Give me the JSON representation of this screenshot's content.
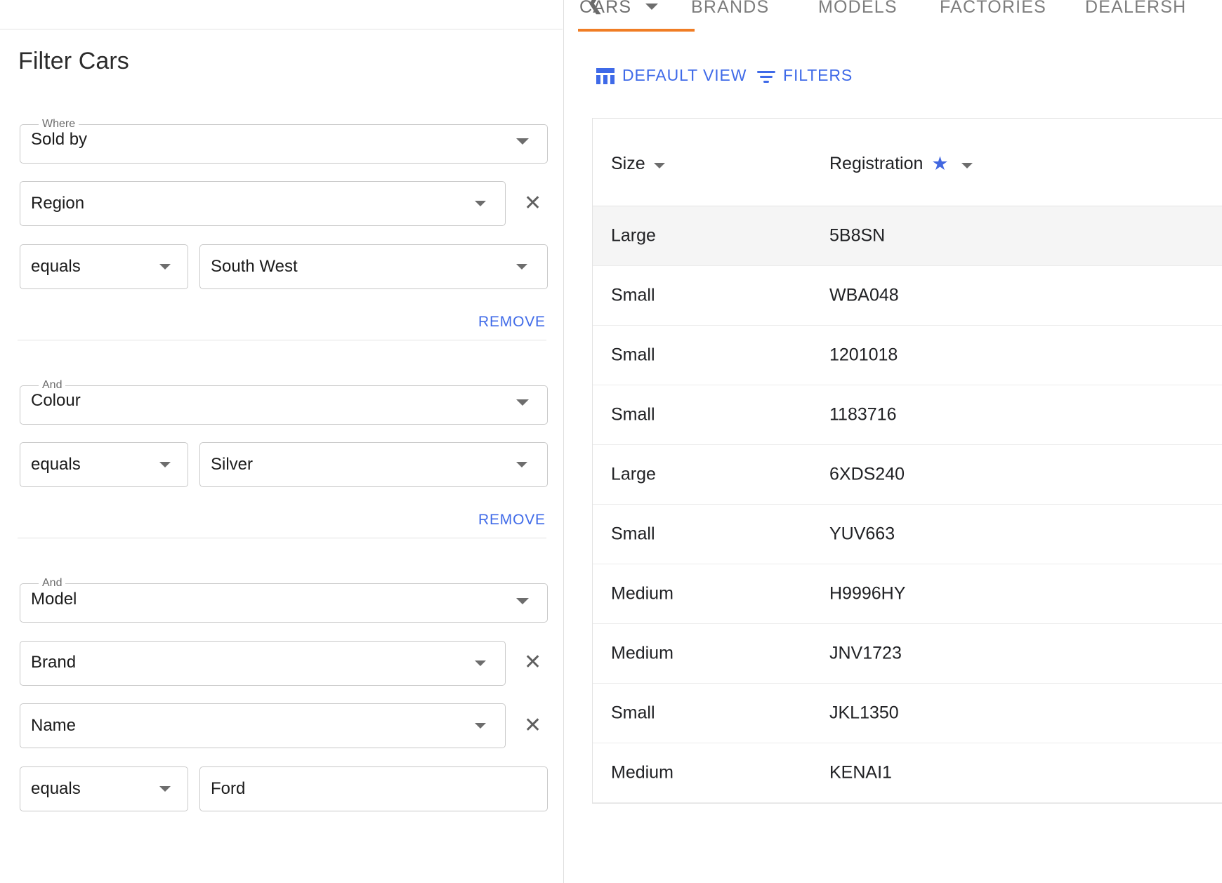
{
  "left_panel": {
    "title": "Filter Cars",
    "collapse_icon": "chevron-left-icon",
    "groups": [
      {
        "legend": "Where",
        "field": "Sold by",
        "subfield": "Region",
        "operator": "equals",
        "value": "South West",
        "remove_label": "REMOVE",
        "clear_icon": "close-icon"
      },
      {
        "legend": "And",
        "field": "Colour",
        "operator": "equals",
        "value": "Silver",
        "remove_label": "REMOVE"
      },
      {
        "legend": "And",
        "field": "Model",
        "subfield": "Brand",
        "subfield2": "Name",
        "operator": "equals",
        "value": "Ford",
        "clear_icon": "close-icon"
      }
    ]
  },
  "right_panel": {
    "tabs": [
      {
        "label": "CARS",
        "active": true,
        "has_caret": true
      },
      {
        "label": "BRANDS",
        "active": false,
        "has_caret": false
      },
      {
        "label": "MODELS",
        "active": false,
        "has_caret": false
      },
      {
        "label": "FACTORIES",
        "active": false,
        "has_caret": false
      },
      {
        "label": "DEALERSH",
        "active": false,
        "has_caret": false
      }
    ],
    "active_tab_color": "#f07d25",
    "accent_color": "#3f6ae8",
    "toolbar": {
      "default_view_label": "DEFAULT VIEW",
      "default_view_icon": "view-column-icon",
      "filters_label": "FILTERS",
      "filters_icon": "filter-list-icon"
    },
    "table": {
      "columns": [
        {
          "label": "Size",
          "sort_icon": "chevron-down-icon",
          "starred": false
        },
        {
          "label": "Registration",
          "sort_icon": "chevron-down-icon",
          "starred": true,
          "star_icon": "star-icon"
        }
      ],
      "rows": [
        {
          "size": "Large",
          "registration": "5B8SN",
          "selected": true
        },
        {
          "size": "Small",
          "registration": "WBA048",
          "selected": false
        },
        {
          "size": "Small",
          "registration": "1201018",
          "selected": false
        },
        {
          "size": "Small",
          "registration": "1183716",
          "selected": false
        },
        {
          "size": "Large",
          "registration": "6XDS240",
          "selected": false
        },
        {
          "size": "Small",
          "registration": "YUV663",
          "selected": false
        },
        {
          "size": "Medium",
          "registration": "H9996HY",
          "selected": false
        },
        {
          "size": "Medium",
          "registration": "JNV1723",
          "selected": false
        },
        {
          "size": "Small",
          "registration": "JKL1350",
          "selected": false
        },
        {
          "size": "Medium",
          "registration": "KENAI1",
          "selected": false
        }
      ]
    }
  }
}
